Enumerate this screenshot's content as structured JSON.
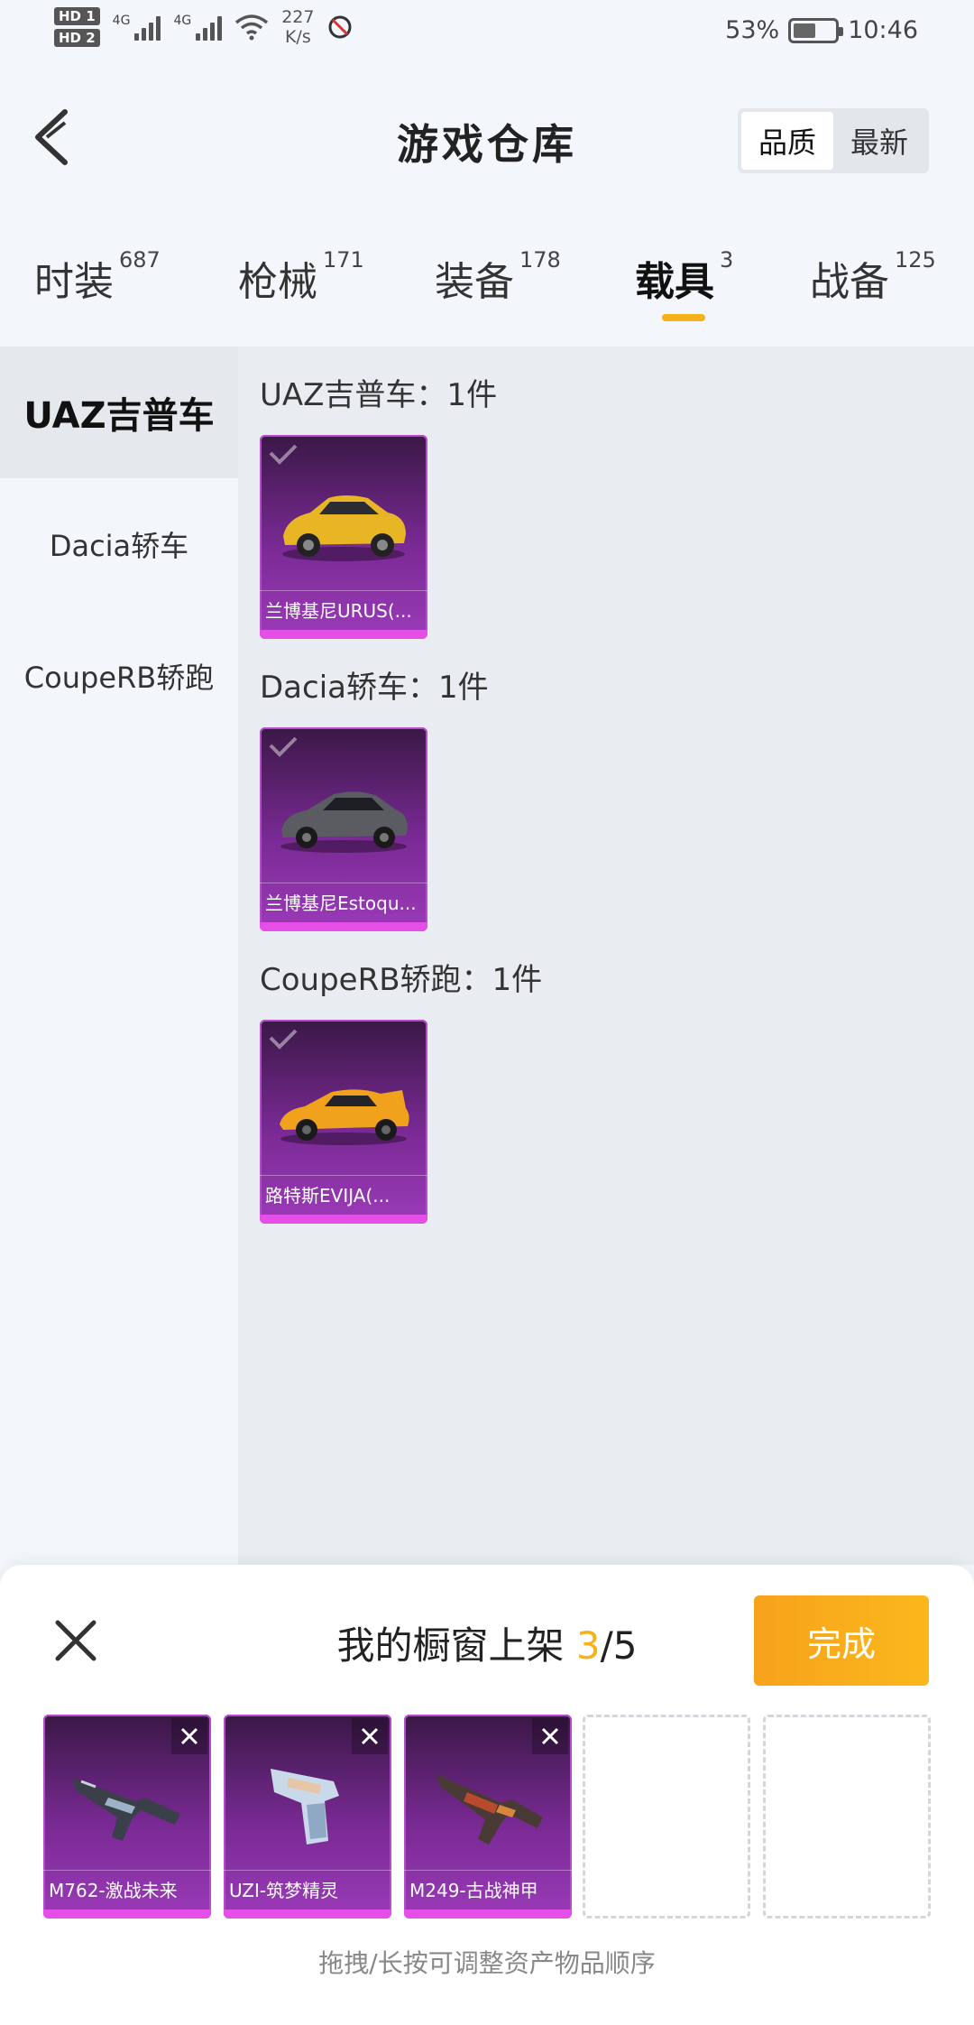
{
  "status_bar": {
    "hd1": "HD 1",
    "hd2": "HD 2",
    "sim1_label": "4G",
    "sim2_label": "4G",
    "speed_value": "227",
    "speed_unit": "K/s",
    "battery_percent": "53%",
    "battery_level": 0.53,
    "time": "10:46"
  },
  "header": {
    "title": "游戏仓库",
    "sort_options": [
      {
        "label": "品质",
        "active": true
      },
      {
        "label": "最新",
        "active": false
      }
    ]
  },
  "tabs": [
    {
      "name": "时装",
      "count": "687",
      "active": false
    },
    {
      "name": "枪械",
      "count": "171",
      "active": false
    },
    {
      "name": "装备",
      "count": "178",
      "active": false
    },
    {
      "name": "载具",
      "count": "3",
      "active": true
    },
    {
      "name": "战备",
      "count": "125",
      "active": false
    }
  ],
  "sidebar": {
    "items": [
      {
        "label": "UAZ吉普车",
        "active": true
      },
      {
        "label": "Dacia轿车",
        "active": false
      },
      {
        "label": "CoupeRB轿跑",
        "active": false
      }
    ]
  },
  "groups": [
    {
      "title": "UAZ吉普车：1件",
      "items": [
        {
          "name": "兰博基尼URUS(...",
          "icon": "yellow-suv-icon"
        }
      ]
    },
    {
      "title": "Dacia轿车：1件",
      "items": [
        {
          "name": "兰博基尼Estoqu...",
          "icon": "gray-sedan-icon"
        }
      ]
    },
    {
      "title": "CoupeRB轿跑：1件",
      "items": [
        {
          "name": "路特斯EVIJA(...",
          "icon": "orange-sportscar-icon"
        }
      ]
    }
  ],
  "showcase": {
    "title_prefix": "我的橱窗上架",
    "current": "3",
    "separator_total": "/5",
    "done_label": "完成",
    "slots": [
      {
        "name": "M762-激战未来",
        "icon": "rifle-icon"
      },
      {
        "name": "UZI-筑梦精灵",
        "icon": "smg-icon"
      },
      {
        "name": "M249-古战神甲",
        "icon": "machinegun-icon"
      }
    ],
    "empty_slots": 2,
    "hint": "拖拽/长按可调整资产物品顺序"
  },
  "colors": {
    "accent": "#f5b21a",
    "card_purple": "#7a2a95",
    "rarity_pink": "#e54fe8"
  }
}
